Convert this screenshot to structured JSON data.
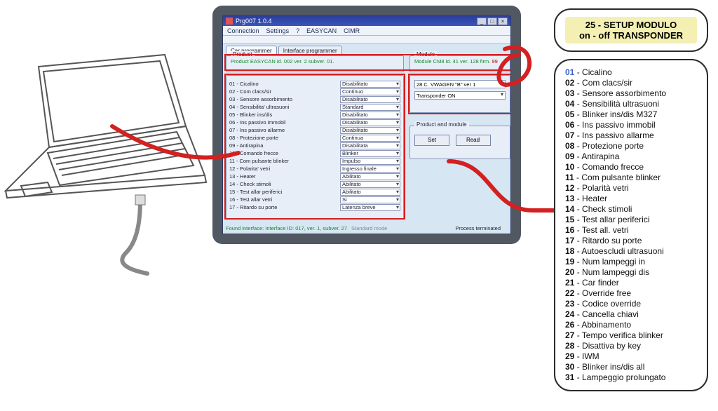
{
  "app": {
    "title": "Prg007 1.0.4",
    "menus": [
      "Connection",
      "Settings",
      "?",
      "EASYCAN",
      "CIMR"
    ],
    "tabs": {
      "car": "Car programmer",
      "iface": "Interface programmer"
    },
    "product_label": "Product",
    "product_info": "Product EASYCAN  id. 002 ver. 2 subver. 01.",
    "module_label": "Module",
    "module_info": "Module CM8 id. 41 ver. 128 firm.",
    "module_count": "99",
    "module_sel1": "28 C. VWAGEN \"B\"    ver 1",
    "module_sel2": "Transponder ON",
    "pm_label": "Product and module",
    "btn_set": "Set",
    "btn_read": "Read",
    "status_found": "Found interface: Interface ID: 017, ver. 1, subver. 27",
    "status_mode": "Standard mode",
    "status_process": "Process terminated"
  },
  "settings": [
    {
      "label": "01 - Cicalino",
      "value": "Disabilitato"
    },
    {
      "label": "02 - Com clacs/sir",
      "value": "Continuo"
    },
    {
      "label": "03 - Sensore assorbimento",
      "value": "Disabilitato"
    },
    {
      "label": "04 - Sensibilita' ultrasuoni",
      "value": "Standard"
    },
    {
      "label": "05 - Blinker ins/dis",
      "value": "Disabilitato"
    },
    {
      "label": "06 - Ins passivo immobil",
      "value": "Disabilitato"
    },
    {
      "label": "07 - Ins passivo allarme",
      "value": "Disabilitato"
    },
    {
      "label": "08 - Protezione porte",
      "value": "Continua"
    },
    {
      "label": "09 - Antirapina",
      "value": "Disabilitata"
    },
    {
      "label": "10 - Comando frecce",
      "value": "Blinker"
    },
    {
      "label": "11 - Com pulsante blinker",
      "value": "Impulso"
    },
    {
      "label": "12 - Polarita' vetri",
      "value": "Ingresso finale"
    },
    {
      "label": "13 - Heater",
      "value": "Abilitato"
    },
    {
      "label": "14 - Check stimoli",
      "value": "Abilitato"
    },
    {
      "label": "15 - Test allar periferici",
      "value": "Abilitato"
    },
    {
      "label": "16 - Test allar vetri",
      "value": "Si"
    },
    {
      "label": "17 - Ritardo su porte",
      "value": "Latenza breve"
    }
  ],
  "side_header": {
    "line1": "25 - SETUP MODULO",
    "line2": "on - off TRANSPONDER"
  },
  "side_items": [
    "01 - Cicalino",
    "02 - Com clacs/sir",
    "03 - Sensore assorbimento",
    "04 - Sensibilità ultrasuoni",
    "05 - Blinker ins/dis M327",
    "06 - Ins passivo immobil",
    "07 - Ins passivo allarme",
    "08 - Protezione porte",
    "09 - Antirapina",
    "10 - Comando frecce",
    "11 - Com pulsante blinker",
    "12 - Polarità vetri",
    "13 - Heater",
    "14 - Check stimoli",
    "15 - Test allar periferici",
    "16 - Test all. vetri",
    "17 - Ritardo su porte",
    "18 - Autoescludi ultrasuoni",
    "19 - Num lampeggi in",
    "20 - Num lampeggi dis",
    "21 - Car finder",
    "22 - Override free",
    "23 - Codice override",
    "24 - Cancella chiavi",
    "26 - Abbinamento",
    "27 - Tempo verifica blinker",
    "28 - Disattiva by key",
    "29 - IWM",
    "30 - Blinker ins/dis all",
    "31 - Lampeggio prolungato"
  ]
}
